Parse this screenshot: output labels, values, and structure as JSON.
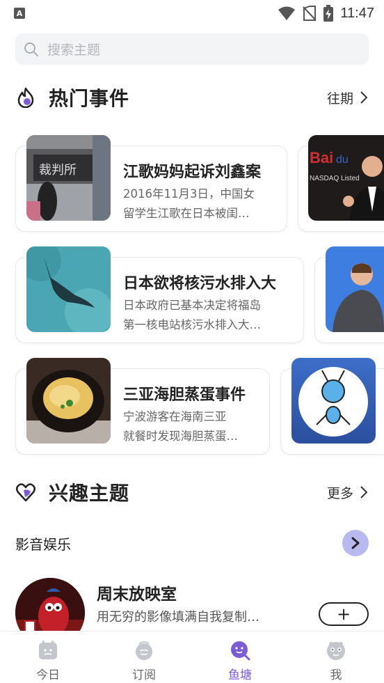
{
  "status_bar": {
    "time": "11:47"
  },
  "search": {
    "placeholder": "搜索主题"
  },
  "hot_events": {
    "title": "热门事件",
    "more_label": "往期",
    "cards": [
      {
        "title": "江歌妈妈起诉刘鑫案",
        "desc_line1": "2016年11月3日，中国女",
        "desc_line2": "留学生江歌在日本被闺…",
        "image": "courthouse-photo"
      },
      {
        "title": "日本欲将核污水排入大",
        "desc_line1": "日本政府已基本决定将福岛",
        "desc_line2": "第一核电站核污水排入大…",
        "image": "manta-ray-photo"
      },
      {
        "title": "三亚海胆蒸蛋事件",
        "desc_line1": "宁波游客在海南三亚",
        "desc_line2": "就餐时发现海胆蒸蛋…",
        "image": "sea-urchin-photo"
      }
    ],
    "peek_images": [
      "baidu-ceo-photo",
      "zuckerberg-photo",
      "ant-logo"
    ]
  },
  "interests": {
    "title": "兴趣主题",
    "more_label": "更多",
    "category": "影音娱乐",
    "topic": {
      "title": "周末放映室",
      "desc": "用无穷的影像填满自我复制…",
      "follow_label": "+"
    }
  },
  "tab_bar": {
    "tabs": [
      {
        "label": "今日",
        "active": false
      },
      {
        "label": "订阅",
        "active": false
      },
      {
        "label": "鱼塘",
        "active": true
      },
      {
        "label": "我",
        "active": false
      }
    ]
  },
  "colors": {
    "accent": "#7b5bd6",
    "arrow_bg": "#b8b9ef",
    "text_primary": "#222222",
    "text_secondary": "#666666"
  }
}
